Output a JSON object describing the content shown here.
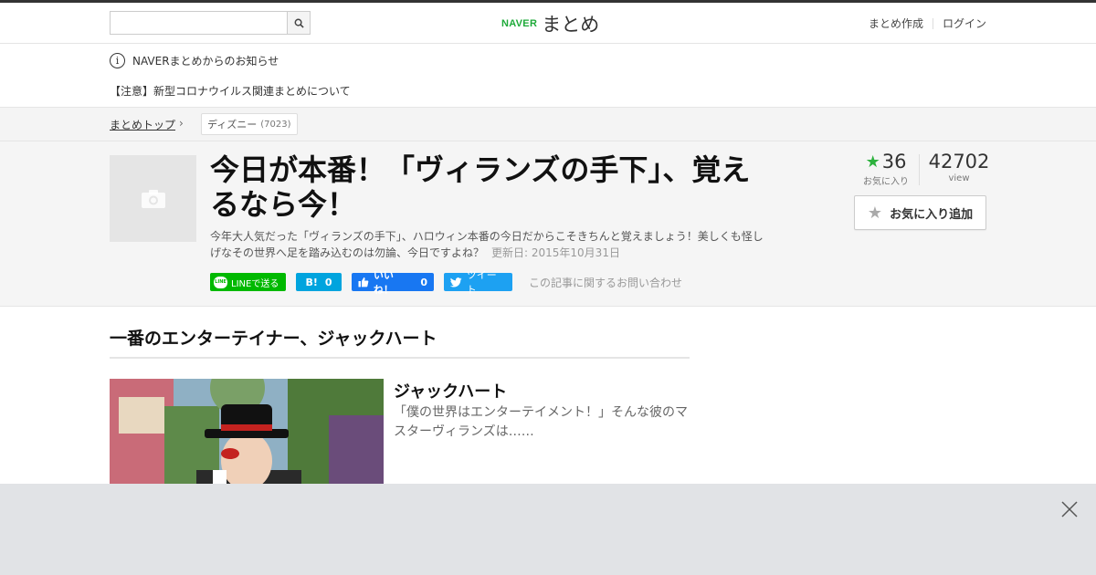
{
  "header": {
    "search_placeholder": "",
    "logo_naver": "NAVER",
    "logo_matome": "まとめ",
    "create_link": "まとめ作成",
    "login_link": "ログイン"
  },
  "notice": {
    "title": "NAVERまとめからのお知らせ",
    "item": "【注意】新型コロナウイルス関連まとめについて"
  },
  "breadcrumb": {
    "home": "まとめトップ",
    "tag_label": "ディズニー",
    "tag_count": "(7023)"
  },
  "article": {
    "title": "今日が本番！「ヴィランズの手下」、覚えるなら今！",
    "description": "今年大人気だった「ヴィランズの手下」、ハロウィン本番の今日だからこそきちんと覚えましょう！美しくも怪しげなその世界へ足を踏み込むのは勿論、今日ですよね？",
    "updated": "更新日: 2015年10月31日"
  },
  "share": {
    "line_label": "LINEで送る",
    "line_badge": "LINE",
    "hatena_label": "B!",
    "hatena_count": "0",
    "fb_label": "いいね！",
    "fb_count": "0",
    "tweet_label": "ツイート",
    "contact": "この記事に関するお問い合わせ"
  },
  "stats": {
    "fav_count": "36",
    "fav_label": "お気に入り",
    "view_count": "42702",
    "view_label": "view",
    "fav_button": "お気に入り追加"
  },
  "section": {
    "heading": "一番のエンターテイナー、ジャックハート"
  },
  "item": {
    "title": "ジャックハート",
    "description": "「僕の世界はエンターテイメント！」そんな彼のマスターヴィランズは……"
  },
  "colors": {
    "naver_green": "#1eaa39",
    "line_green": "#00b900",
    "hatena_blue": "#00a4de",
    "fb_blue": "#1877f2",
    "twitter_blue": "#1da1f2",
    "star_green": "#2db23e",
    "overlay_gray": "#e1e3e6"
  }
}
